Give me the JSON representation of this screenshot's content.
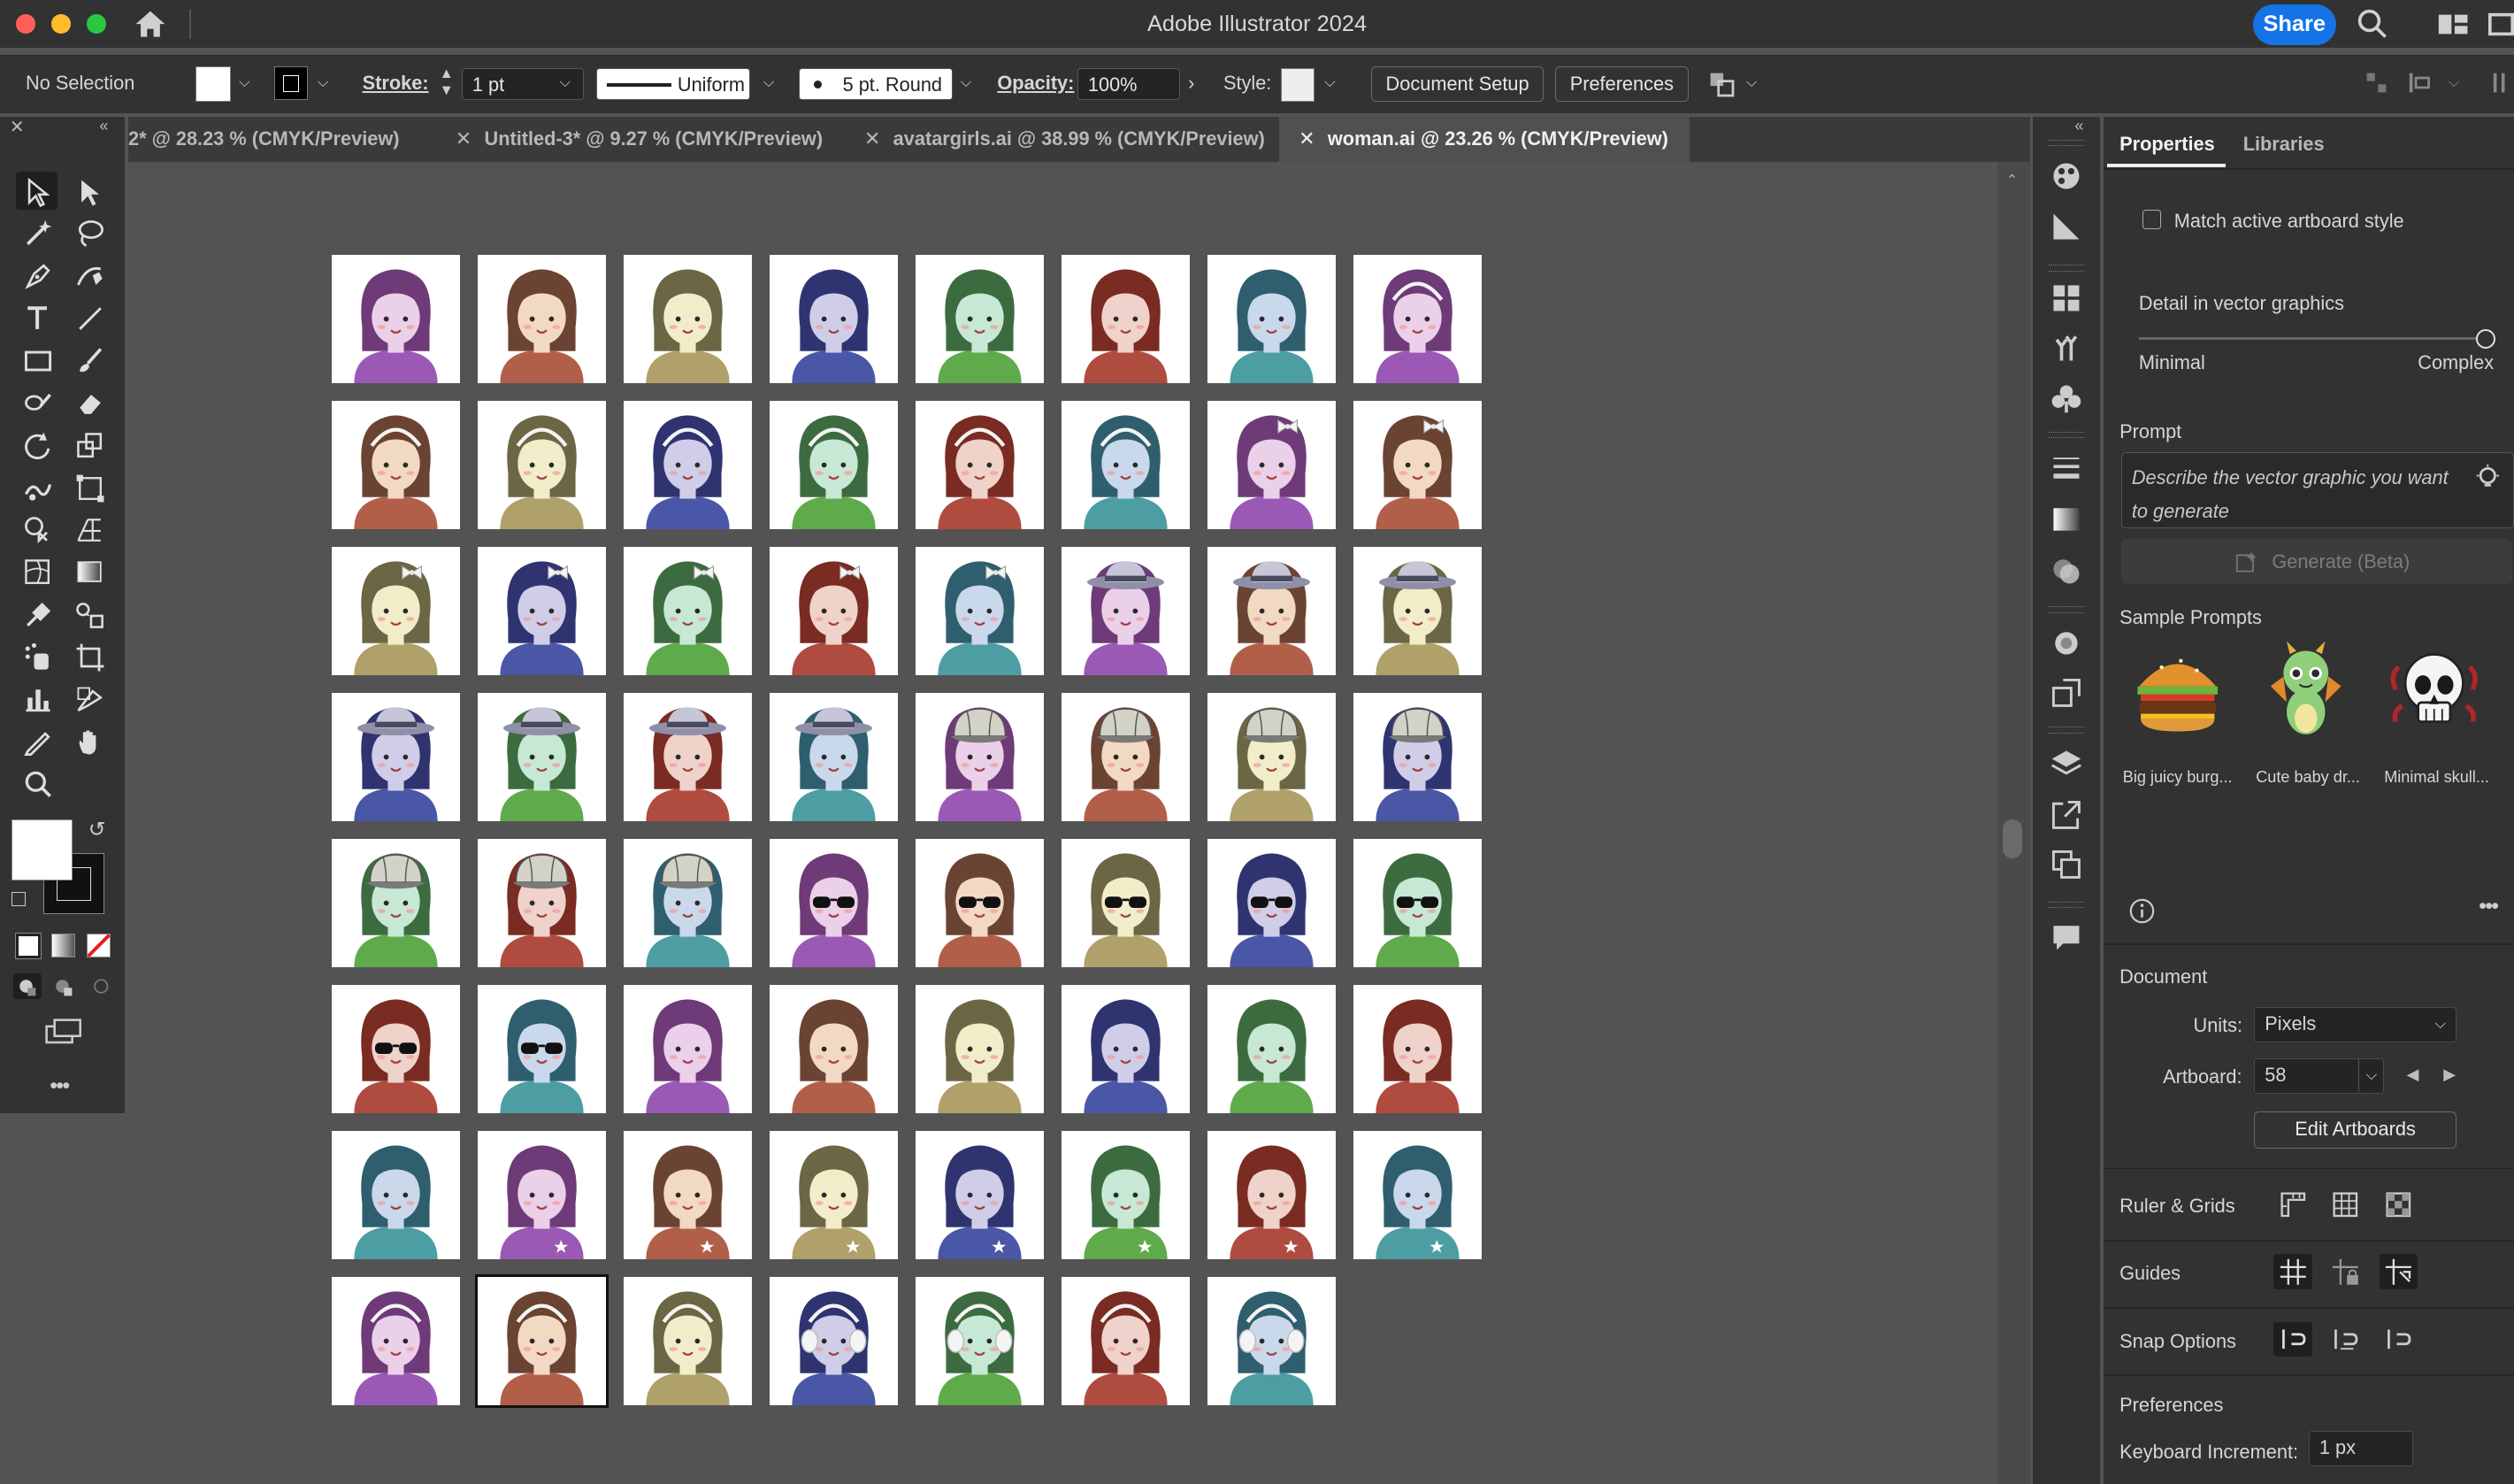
{
  "app": {
    "title": "Adobe Illustrator 2024",
    "share_label": "Share"
  },
  "controlbar": {
    "selection": "No Selection",
    "stroke_label": "Stroke:",
    "stroke_value": "1 pt",
    "stroke_profile": "Uniform",
    "brush": "5 pt. Round",
    "opacity_label": "Opacity:",
    "opacity_value": "100%",
    "style_label": "Style:",
    "document_setup": "Document Setup",
    "preferences": "Preferences"
  },
  "tabs": [
    {
      "label": "2* @ 28.23 % (CMYK/Preview)",
      "active": false
    },
    {
      "label": "Untitled-3* @ 9.27 % (CMYK/Preview)",
      "active": false
    },
    {
      "label": "avatargirls.ai @ 38.99 % (CMYK/Preview)",
      "active": false
    },
    {
      "label": "woman.ai @ 23.26 % (CMYK/Preview)",
      "active": true
    }
  ],
  "tools": [
    "selection-tool",
    "direct-selection-tool",
    "magic-wand-tool",
    "lasso-tool",
    "pen-tool",
    "curvature-tool",
    "type-tool",
    "line-segment-tool",
    "rectangle-tool",
    "paintbrush-tool",
    "shaper-tool",
    "eraser-tool",
    "rotate-tool",
    "scale-tool",
    "warp-tool",
    "free-transform-tool",
    "shape-builder-tool",
    "perspective-grid-tool",
    "mesh-tool",
    "gradient-tool",
    "eyedropper-tool",
    "blend-tool",
    "symbol-sprayer-tool",
    "artboard-tool",
    "column-graph-tool",
    "slice-tool",
    "pencil-tool",
    "hand-tool",
    "zoom-tool"
  ],
  "artboards": {
    "count": 63,
    "selected_index": 57,
    "palettes": [
      {
        "name": "purple",
        "hair": "#6e3a78",
        "skin": "#ead0e8",
        "shirt": "#9b59b6"
      },
      {
        "name": "brown",
        "hair": "#6b4332",
        "skin": "#f2d9c4",
        "shirt": "#b25f49"
      },
      {
        "name": "olive",
        "hair": "#6b6644",
        "skin": "#f1edc9",
        "shirt": "#b0a06a"
      },
      {
        "name": "navy",
        "hair": "#2f3470",
        "skin": "#cfcde8",
        "shirt": "#4a56a6"
      },
      {
        "name": "green",
        "hair": "#3d6b40",
        "skin": "#c6e8d4",
        "shirt": "#5faa4b"
      },
      {
        "name": "red",
        "hair": "#7a2b22",
        "skin": "#efd2c9",
        "shirt": "#b04b40"
      },
      {
        "name": "teal",
        "hair": "#2f5e6e",
        "skin": "#c9d8ea",
        "shirt": "#4c9ea3"
      }
    ],
    "items": [
      {
        "p": 0,
        "a": "none"
      },
      {
        "p": 1,
        "a": "none"
      },
      {
        "p": 2,
        "a": "none"
      },
      {
        "p": 3,
        "a": "none"
      },
      {
        "p": 4,
        "a": "none"
      },
      {
        "p": 5,
        "a": "none"
      },
      {
        "p": 6,
        "a": "none"
      },
      {
        "p": 0,
        "a": "headband"
      },
      {
        "p": 1,
        "a": "headband"
      },
      {
        "p": 2,
        "a": "headband"
      },
      {
        "p": 3,
        "a": "headband"
      },
      {
        "p": 4,
        "a": "headband"
      },
      {
        "p": 5,
        "a": "headband"
      },
      {
        "p": 6,
        "a": "headband"
      },
      {
        "p": 0,
        "a": "bow"
      },
      {
        "p": 1,
        "a": "bow"
      },
      {
        "p": 2,
        "a": "bow"
      },
      {
        "p": 3,
        "a": "bow"
      },
      {
        "p": 4,
        "a": "bow"
      },
      {
        "p": 5,
        "a": "bow"
      },
      {
        "p": 6,
        "a": "bow"
      },
      {
        "p": 0,
        "a": "hat"
      },
      {
        "p": 1,
        "a": "hat"
      },
      {
        "p": 2,
        "a": "hat"
      },
      {
        "p": 3,
        "a": "hat"
      },
      {
        "p": 4,
        "a": "hat"
      },
      {
        "p": 5,
        "a": "hat"
      },
      {
        "p": 6,
        "a": "hat"
      },
      {
        "p": 0,
        "a": "cap"
      },
      {
        "p": 1,
        "a": "cap"
      },
      {
        "p": 2,
        "a": "cap"
      },
      {
        "p": 3,
        "a": "cap"
      },
      {
        "p": 4,
        "a": "cap"
      },
      {
        "p": 5,
        "a": "cap"
      },
      {
        "p": 6,
        "a": "cap"
      },
      {
        "p": 0,
        "a": "glasses"
      },
      {
        "p": 1,
        "a": "glasses"
      },
      {
        "p": 2,
        "a": "glasses"
      },
      {
        "p": 3,
        "a": "glasses"
      },
      {
        "p": 4,
        "a": "glasses"
      },
      {
        "p": 5,
        "a": "glasses"
      },
      {
        "p": 6,
        "a": "glasses"
      },
      {
        "p": 0,
        "a": "none"
      },
      {
        "p": 1,
        "a": "none"
      },
      {
        "p": 2,
        "a": "none"
      },
      {
        "p": 3,
        "a": "none"
      },
      {
        "p": 4,
        "a": "none"
      },
      {
        "p": 5,
        "a": "none"
      },
      {
        "p": 6,
        "a": "none"
      },
      {
        "p": 0,
        "a": "star"
      },
      {
        "p": 1,
        "a": "star"
      },
      {
        "p": 2,
        "a": "star"
      },
      {
        "p": 3,
        "a": "star"
      },
      {
        "p": 4,
        "a": "star"
      },
      {
        "p": 5,
        "a": "star"
      },
      {
        "p": 6,
        "a": "star"
      },
      {
        "p": 0,
        "a": "headband"
      },
      {
        "p": 1,
        "a": "headband"
      },
      {
        "p": 2,
        "a": "headband"
      },
      {
        "p": 3,
        "a": "earmuffs"
      },
      {
        "p": 4,
        "a": "earmuffs"
      },
      {
        "p": 5,
        "a": "headband"
      },
      {
        "p": 6,
        "a": "earmuffs"
      }
    ]
  },
  "properties": {
    "tab_properties": "Properties",
    "tab_libraries": "Libraries",
    "match_artboard_style": "Match active artboard style",
    "detail_label": "Detail in vector graphics",
    "detail_min": "Minimal",
    "detail_max": "Complex",
    "detail_value": 1.0,
    "prompt_heading": "Prompt",
    "prompt_placeholder": "Describe the vector graphic you want to generate",
    "generate_label": "Generate (Beta)",
    "sample_prompts_heading": "Sample Prompts",
    "samples": [
      "Big juicy burg...",
      "Cute baby dr...",
      "Minimal skull..."
    ],
    "document_heading": "Document",
    "units_label": "Units:",
    "units_value": "Pixels",
    "artboard_label": "Artboard:",
    "artboard_value": "58",
    "edit_artboards": "Edit Artboards",
    "ruler_grids": "Ruler & Grids",
    "guides": "Guides",
    "snap_options": "Snap Options",
    "preferences_heading": "Preferences",
    "keyboard_increment_label": "Keyboard Increment:",
    "keyboard_increment_value": "1 px"
  },
  "colors": {
    "accent": "#1473e6",
    "canvas": "#535353",
    "panel": "#323232"
  }
}
